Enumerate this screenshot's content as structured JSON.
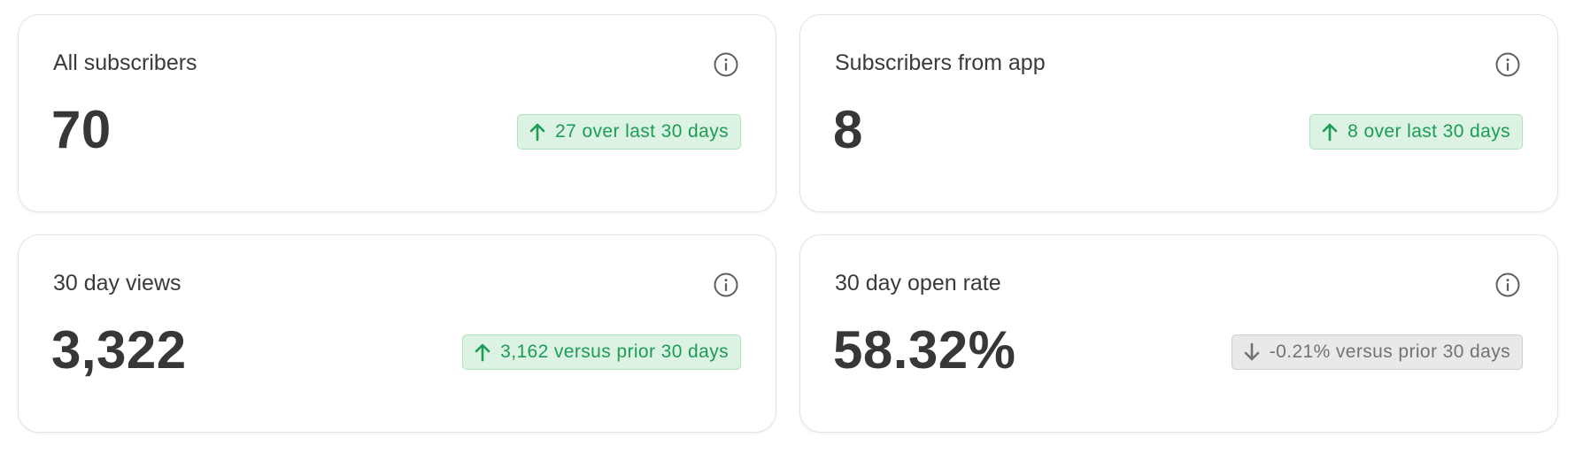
{
  "cards": [
    {
      "title": "All subscribers",
      "value": "70",
      "badge": {
        "direction": "up",
        "text": "27 over last 30 days",
        "icon": "arrow-up-icon"
      },
      "info_icon": "info-icon"
    },
    {
      "title": "Subscribers from app",
      "value": "8",
      "badge": {
        "direction": "up",
        "text": "8 over last 30 days",
        "icon": "arrow-up-icon"
      },
      "info_icon": "info-icon"
    },
    {
      "title": "30 day views",
      "value": "3,322",
      "badge": {
        "direction": "up",
        "text": "3,162 versus prior 30 days",
        "icon": "arrow-up-icon"
      },
      "info_icon": "info-icon"
    },
    {
      "title": "30 day open rate",
      "value": "58.32%",
      "badge": {
        "direction": "down",
        "text": "-0.21% versus prior 30 days",
        "icon": "arrow-down-icon"
      },
      "info_icon": "info-icon"
    }
  ],
  "colors": {
    "positive_text": "#1c9c55",
    "positive_bg": "#dcf3e4",
    "neutral_text": "#737373",
    "neutral_bg": "#e9e9e9"
  }
}
